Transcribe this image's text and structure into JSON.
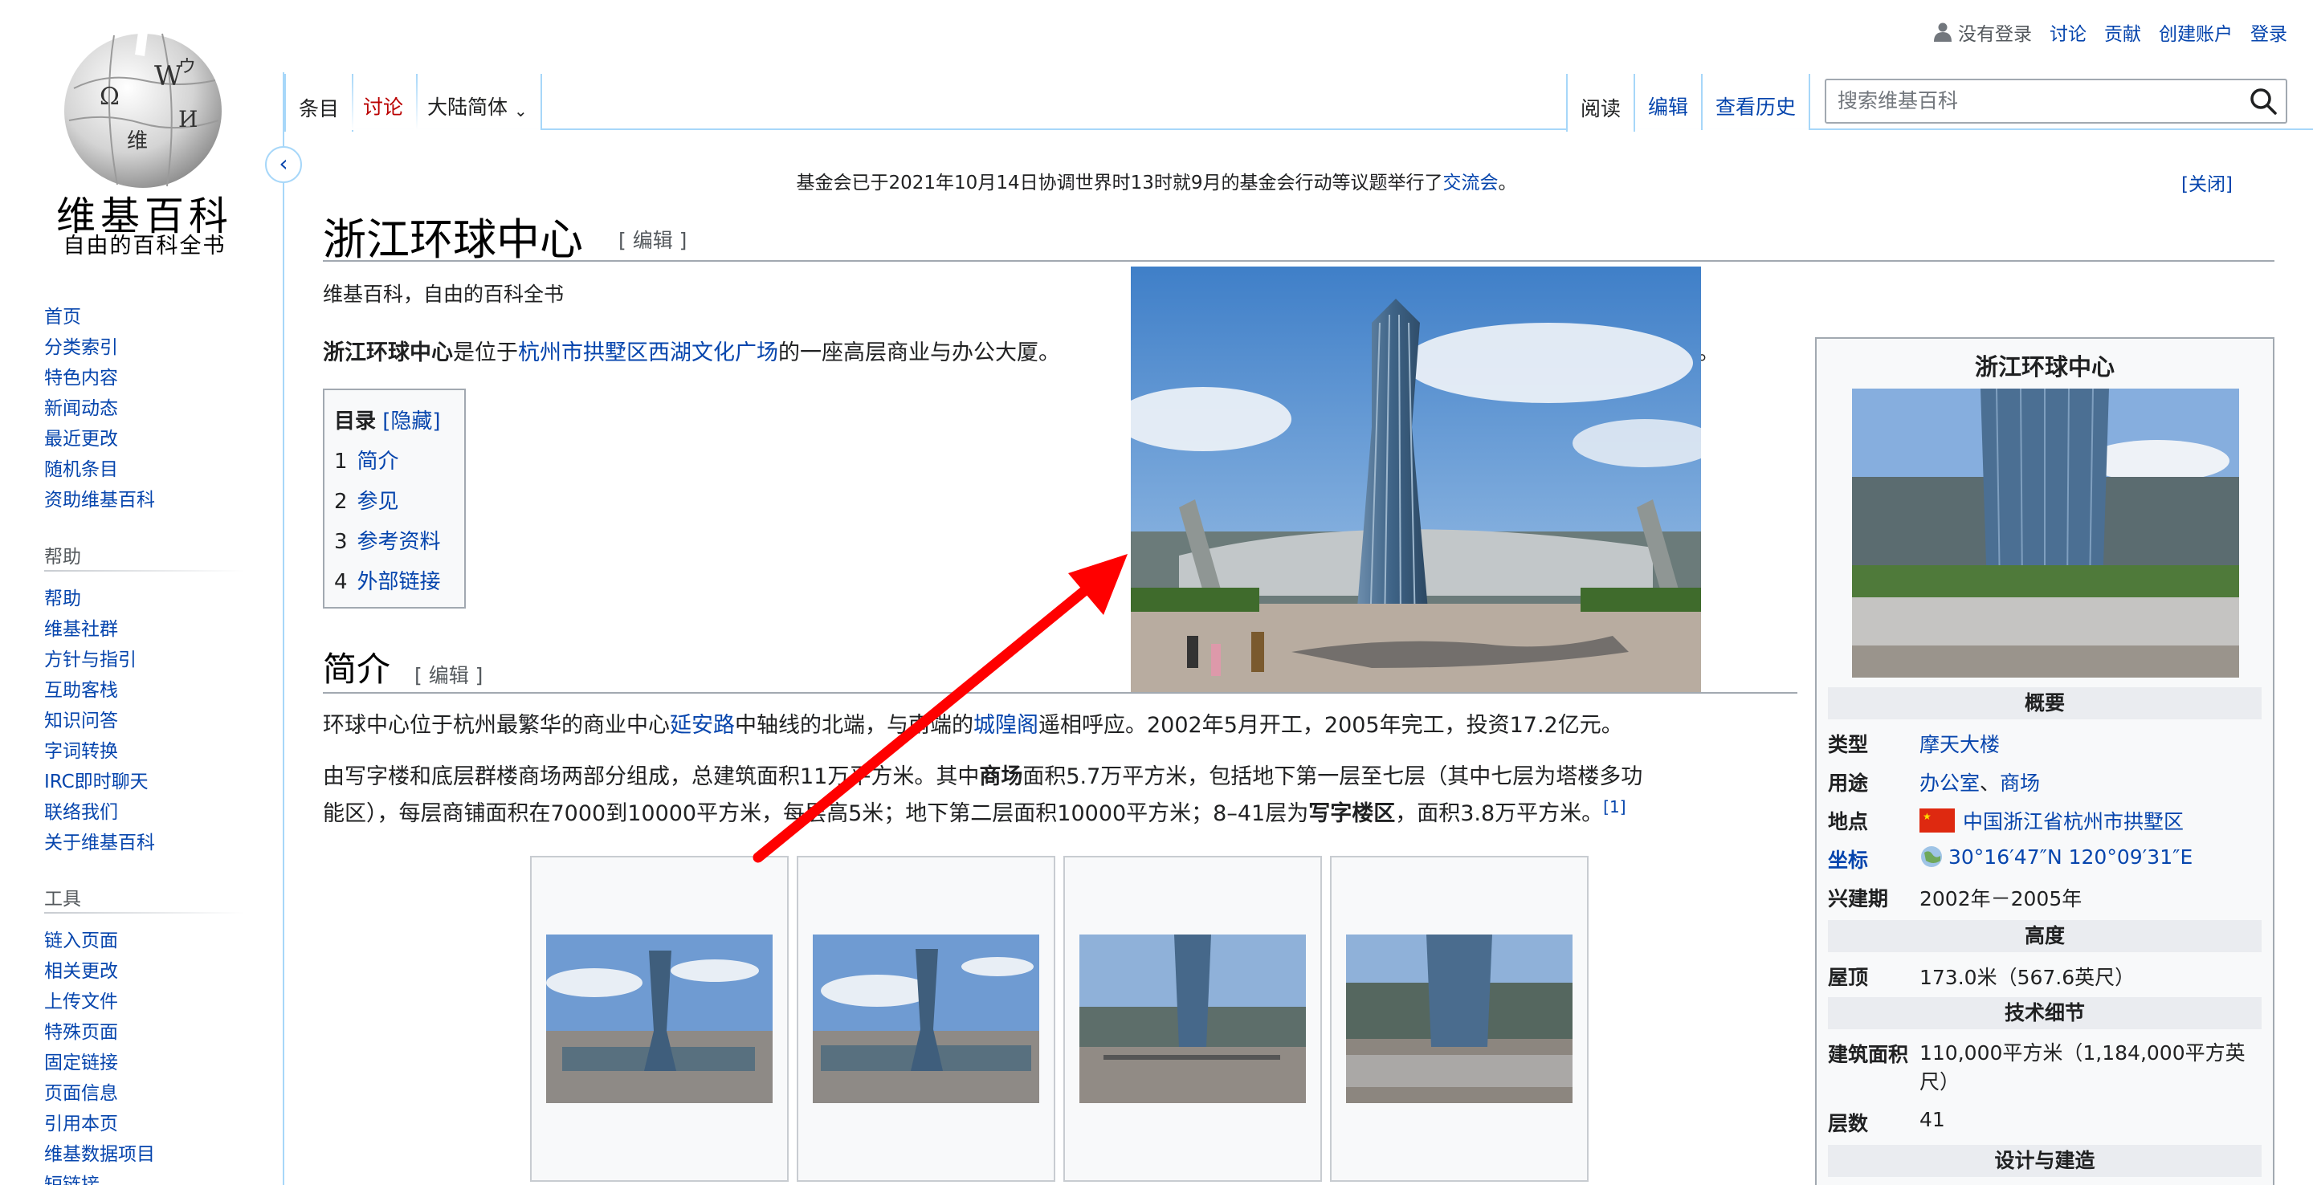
{
  "logo": {
    "wordmark": "维基百科",
    "tagline": "自由的百科全书"
  },
  "sidebar": {
    "nav": [
      "首页",
      "分类索引",
      "特色内容",
      "新闻动态",
      "最近更改",
      "随机条目",
      "资助维基百科"
    ],
    "help_heading": "帮助",
    "help": [
      "帮助",
      "维基社群",
      "方针与指引",
      "互助客栈",
      "知识问答",
      "字词转换",
      "IRC即时聊天",
      "联络我们",
      "关于维基百科"
    ],
    "tools_heading": "工具",
    "tools": [
      "链入页面",
      "相关更改",
      "上传文件",
      "特殊页面",
      "固定链接",
      "页面信息",
      "引用本页",
      "维基数据项目",
      "短链接"
    ]
  },
  "personal": {
    "not_logged_in": "没有登录",
    "talk": "讨论",
    "contributions": "贡献",
    "create_account": "创建账户",
    "login": "登录"
  },
  "tabs": {
    "article": "条目",
    "talk": "讨论",
    "variant": "大陆简体",
    "read": "阅读",
    "edit": "编辑",
    "history": "查看历史"
  },
  "search": {
    "placeholder": "搜索维基百科"
  },
  "notice": {
    "text": "基金会已于2021年10月14日协调世界时13时就9月的基金会行动等议题举行了",
    "link": "交流会",
    "end": "。",
    "close": "[关闭]"
  },
  "article": {
    "title": "浙江环球中心",
    "edit_link": "[ 编辑 ]",
    "site_sub": "维基百科，自由的百科全书",
    "lead_bold": "浙江环球中心",
    "lead_mid": "是位于",
    "lead_link": "杭州市拱墅区西湖文化广场",
    "lead_end": "的一座高层商业与办公大厦。",
    "lead_tail": "。",
    "toc": {
      "title": "目录",
      "toggle": "[隐藏]",
      "items": [
        {
          "num": "1",
          "label": "简介"
        },
        {
          "num": "2",
          "label": "参见"
        },
        {
          "num": "3",
          "label": "参考资料"
        },
        {
          "num": "4",
          "label": "外部链接"
        }
      ]
    },
    "section_intro": "简介",
    "section_edit": "[ 编辑 ]",
    "p1_a": "环球中心位于杭州最繁华的商业中心",
    "p1_link1": "延安路",
    "p1_b": "中轴线的北端，与南端的",
    "p1_link2": "城隍阁",
    "p1_c": "遥相呼应。2002年5月开工，2005年完工，投资17.2亿元。",
    "p2_a": "由写字楼和底层群楼商场两部分组成，总建筑面积11万平方米。其中",
    "p2_b1": "商场",
    "p2_c": "面积5.7万平方米，包括地下第一层至七层（其中七层为塔楼多功",
    "p2_d": "能区），每层商铺面积在7000到10000平方米，每层高5米；地下第二层面积10000平方米；8–41层为",
    "p2_b2": "写字楼区",
    "p2_e": "，面积3.8万平方米。",
    "ref": "[1]"
  },
  "infobox": {
    "title": "浙江环球中心",
    "section_overview": "概要",
    "type_label": "类型",
    "type_val": "摩天大楼",
    "use_label": "用途",
    "use_val1": "办公室",
    "use_sep": "、",
    "use_val2": "商场",
    "loc_label": "地点",
    "loc_val": "中国浙江省杭州市拱墅区",
    "coord_label": "坐标",
    "coord_val": "30°16′47″N 120°09′31″E",
    "built_label": "兴建期",
    "built_val": "2002年－2005年",
    "section_height": "高度",
    "roof_label": "屋顶",
    "roof_val": "173.0米（567.6英尺）",
    "section_tech": "技术细节",
    "area_label": "建筑面积",
    "area_val1": "110,000平方米（1,184,000平方英",
    "area_val2": "尺）",
    "floors_label": "层数",
    "floors_val": "41",
    "section_design": "设计与建造"
  },
  "colors": {
    "link": "#0645ad",
    "talk_tab": "#ba0000",
    "arrow": "#ff0000",
    "tab_border": "#a7d7f9"
  }
}
